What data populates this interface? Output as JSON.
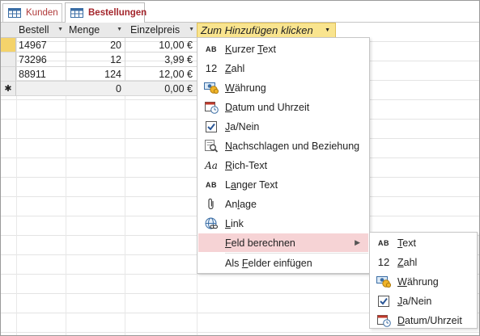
{
  "tabs": [
    {
      "label": "Kunden",
      "active": false
    },
    {
      "label": "Bestellungen",
      "active": true
    }
  ],
  "columns": [
    {
      "label": "Bestell"
    },
    {
      "label": "Menge"
    },
    {
      "label": "Einzelpreis"
    }
  ],
  "add_column_label": "Zum Hinzufügen klicken",
  "rows": [
    {
      "bestell": "14967",
      "menge": "20",
      "einzelpreis": "10,00 €"
    },
    {
      "bestell": "73296",
      "menge": "12",
      "einzelpreis": "3,99 €"
    },
    {
      "bestell": "88911",
      "menge": "124",
      "einzelpreis": "12,00 €"
    }
  ],
  "new_row": {
    "marker": "✱",
    "menge": "0",
    "einzelpreis": "0,00 €"
  },
  "menu": {
    "items": [
      {
        "icon": "short-text-icon",
        "icon_text": "AB",
        "pre": "",
        "acc": "K",
        "post": "urzer ",
        "acc2": "T",
        "post2": "ext"
      },
      {
        "icon": "number-icon",
        "icon_text": "12",
        "pre": "",
        "acc": "Z",
        "post": "ahl"
      },
      {
        "icon": "currency-icon",
        "pre": "",
        "acc": "W",
        "post": "ährung"
      },
      {
        "icon": "date-time-icon",
        "pre": "",
        "acc": "D",
        "post": "atum und Uhrzeit"
      },
      {
        "icon": "checkbox-icon",
        "pre": "",
        "acc": "J",
        "post": "a/Nein"
      },
      {
        "icon": "lookup-icon",
        "pre": "",
        "acc": "N",
        "post": "achschlagen und Beziehung"
      },
      {
        "icon": "rich-text-icon",
        "icon_text": "Aa",
        "pre": "",
        "acc": "R",
        "post": "ich-Text"
      },
      {
        "icon": "long-text-icon",
        "icon_text": "AB",
        "pre": "L",
        "acc": "a",
        "post": "nger Text"
      },
      {
        "icon": "attachment-icon",
        "pre": "An",
        "acc": "l",
        "post": "age"
      },
      {
        "icon": "link-icon",
        "pre": "",
        "acc": "L",
        "post": "ink"
      },
      {
        "icon": "",
        "pre": "",
        "acc": "F",
        "post": "eld berechnen",
        "highlighted": true,
        "submenu": true
      },
      {
        "icon": "",
        "pre": "Als ",
        "acc": "F",
        "post": "elder einfügen"
      }
    ]
  },
  "submenu": {
    "items": [
      {
        "icon": "short-text-icon",
        "icon_text": "AB",
        "pre": "",
        "acc": "T",
        "post": "ext"
      },
      {
        "icon": "number-icon",
        "icon_text": "12",
        "pre": "",
        "acc": "Z",
        "post": "ahl"
      },
      {
        "icon": "currency-icon",
        "pre": "",
        "acc": "W",
        "post": "ährung"
      },
      {
        "icon": "checkbox-icon",
        "pre": "",
        "acc": "J",
        "post": "a/Nein"
      },
      {
        "icon": "date-time-icon",
        "pre": "",
        "acc": "D",
        "post": "atum/Uhrzeit"
      }
    ]
  },
  "colors": {
    "accent": "#a4262c",
    "current_row": "#f4d36b",
    "add_header": "#f9e48e",
    "menu_highlight": "#f6d3d5"
  }
}
